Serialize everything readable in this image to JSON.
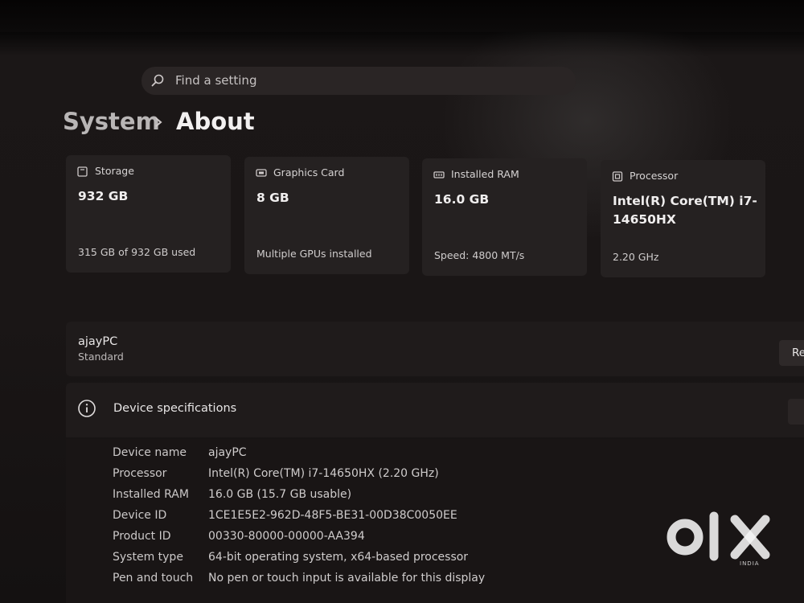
{
  "search": {
    "placeholder": "Find a setting"
  },
  "breadcrumb": {
    "parent": "System",
    "current": "About"
  },
  "cards": [
    {
      "icon": "storage-icon",
      "title": "Storage",
      "value": "932 GB",
      "sub": "315 GB of 932 GB used"
    },
    {
      "icon": "graphics-card-icon",
      "title": "Graphics Card",
      "value": "8 GB",
      "sub": "Multiple GPUs installed"
    },
    {
      "icon": "ram-icon",
      "title": "Installed RAM",
      "value": "16.0 GB",
      "sub": "Speed: 4800 MT/s"
    },
    {
      "icon": "processor-icon",
      "title": "Processor",
      "value": "Intel(R) Core(TM) i7-14650HX",
      "sub": "2.20 GHz"
    }
  ],
  "device": {
    "name": "ajayPC",
    "edition": "Standard",
    "rename_label": "Re"
  },
  "specs": {
    "title": "Device specifications",
    "rows": [
      {
        "label": "Device name",
        "value": "ajayPC"
      },
      {
        "label": "Processor",
        "value": "Intel(R) Core(TM) i7-14650HX (2.20 GHz)"
      },
      {
        "label": "Installed RAM",
        "value": "16.0 GB (15.7 GB usable)"
      },
      {
        "label": "Device ID",
        "value": "1CE1E5E2-962D-48F5-BE31-00D38C0050EE"
      },
      {
        "label": "Product ID",
        "value": "00330-80000-00000-AA394"
      },
      {
        "label": "System type",
        "value": "64-bit operating system, x64-based processor"
      },
      {
        "label": "Pen and touch",
        "value": "No pen or touch input is available for this display"
      }
    ]
  },
  "watermark": {
    "brand": "OLX",
    "region": "INDIA"
  },
  "colors": {
    "background": "#1a1616",
    "card": "#252121",
    "panel": "#1f1b1b",
    "text": "#e8e6e6"
  }
}
